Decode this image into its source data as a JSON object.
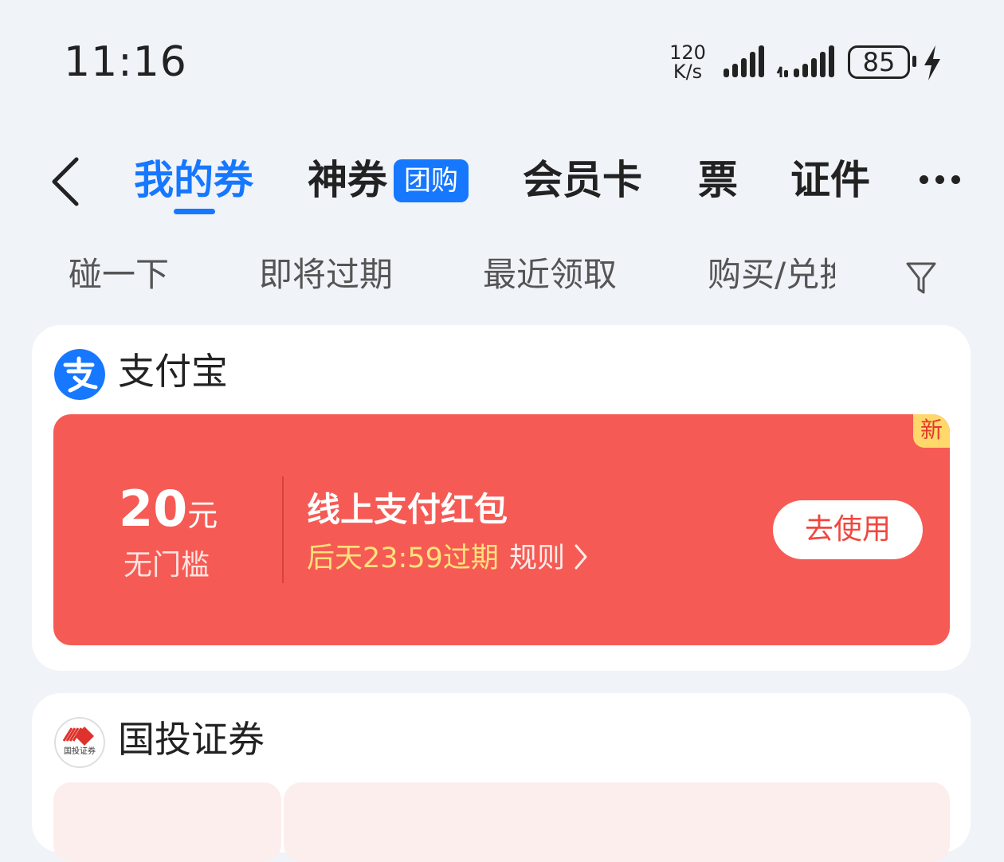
{
  "status_bar": {
    "time": "11:16",
    "net_speed_value": "120",
    "net_speed_unit": "K/s",
    "battery": "85"
  },
  "tabs": [
    {
      "label": "我的券",
      "active": true
    },
    {
      "label": "神券",
      "badge": "团购"
    },
    {
      "label": "会员卡"
    },
    {
      "label": "票"
    },
    {
      "label": "证件"
    }
  ],
  "filters": [
    "碰一下",
    "即将过期",
    "最近领取",
    "购买/兑换"
  ],
  "cards": [
    {
      "brand": "支付宝",
      "coupon": {
        "amount": "20",
        "unit": "元",
        "threshold": "无门槛",
        "title": "线上支付红包",
        "expire": "后天23:59过期",
        "rules": "规则",
        "action": "去使用",
        "tag": "新"
      }
    },
    {
      "brand": "国投证券",
      "logo_text": "国投证券"
    }
  ],
  "colors": {
    "accent": "#1677ff",
    "coupon_bg": "#f55b54",
    "expire_text": "#ffe27a",
    "new_tag_bg": "#ffd76b"
  }
}
